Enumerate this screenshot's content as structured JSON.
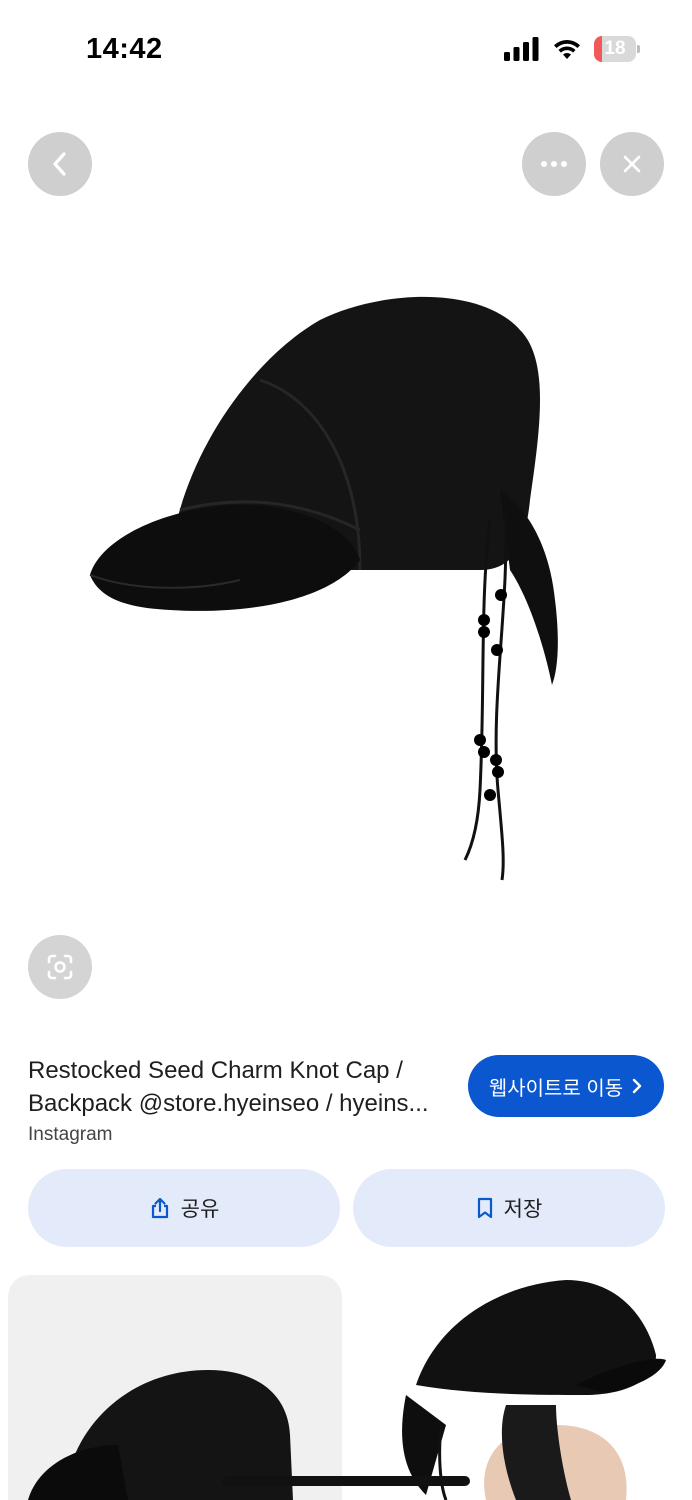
{
  "status_bar": {
    "time": "14:42",
    "battery": "18",
    "battery_level": 0.18
  },
  "result": {
    "title_line1": "Restocked Seed Charm Knot Cap /",
    "title_line2": "Backpack @store.hyeinseo / hyeins...",
    "source": "Instagram"
  },
  "actions": {
    "visit_label": "웹사이트로 이동",
    "share_label": "공유",
    "save_label": "저장"
  },
  "colors": {
    "accent": "#0b57d0",
    "pill_bg": "#e3ebfb",
    "circle_bg": "#cfcfcf"
  },
  "icons": [
    "back-arrow",
    "more-dots",
    "close-x",
    "lens",
    "share",
    "bookmark",
    "chevron-right"
  ]
}
